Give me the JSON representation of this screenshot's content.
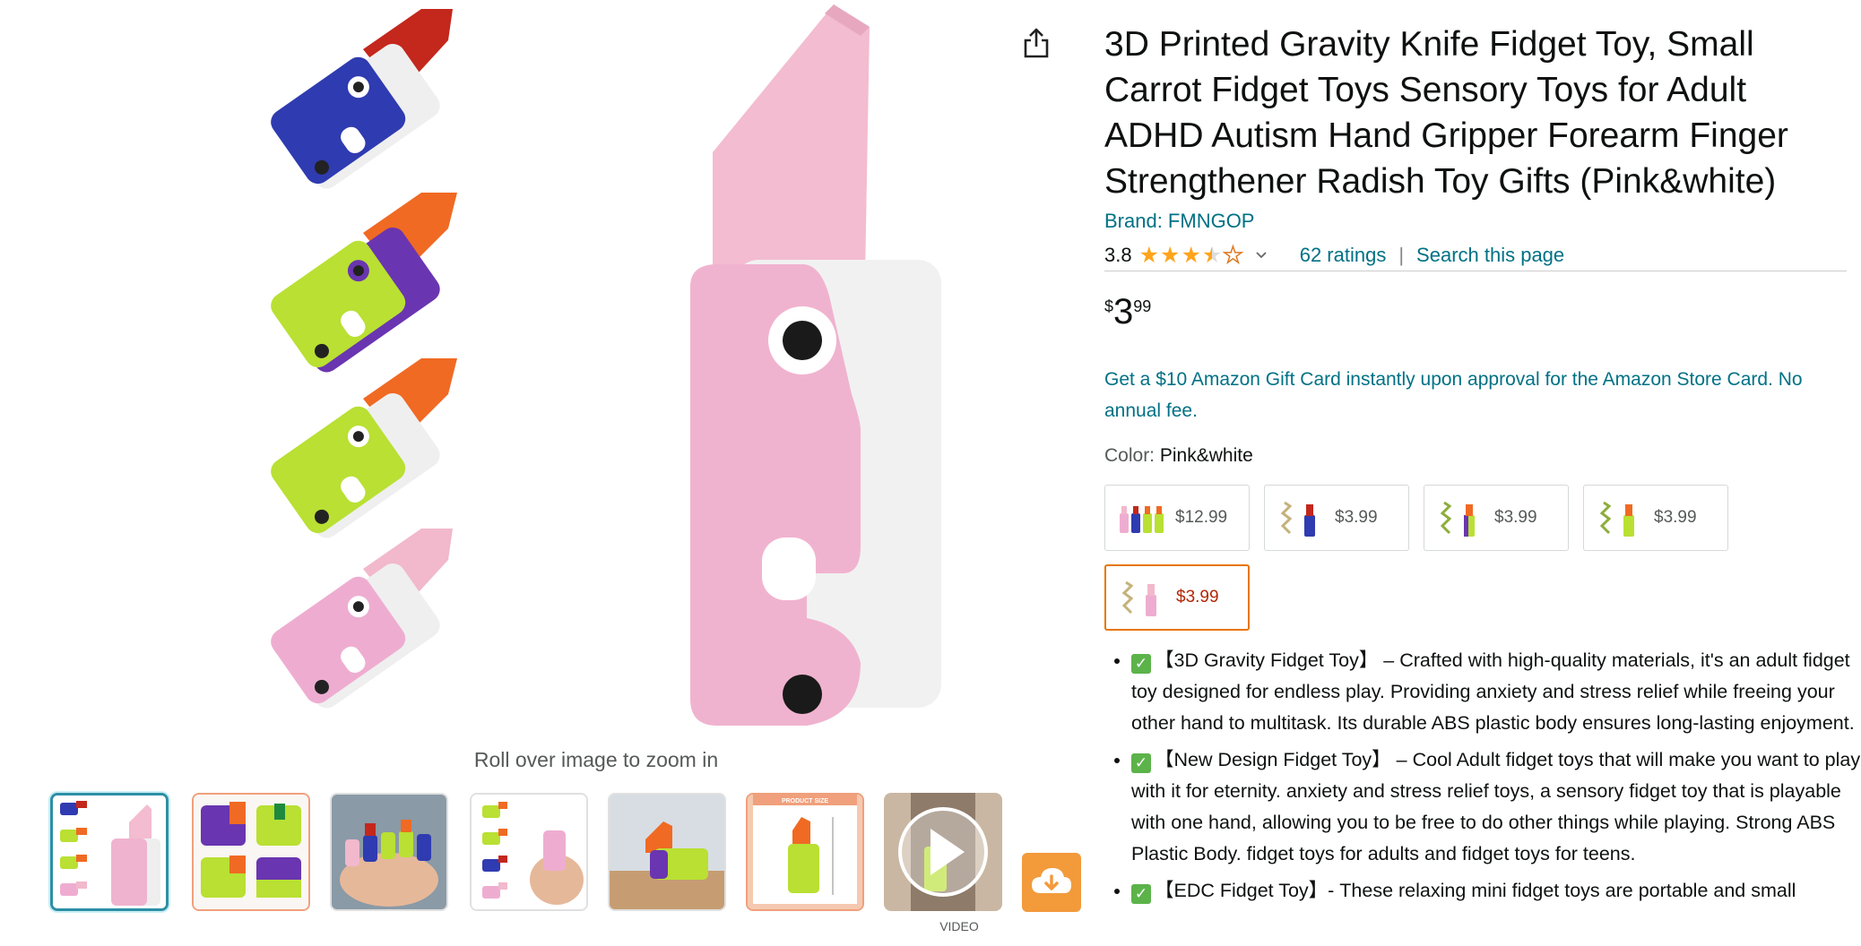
{
  "product": {
    "title": "3D Printed Gravity Knife Fidget Toy, Small Carrot Fidget Toys Sensory Toys for Adult ADHD Autism Hand Gripper Forearm Finger Strengthener Radish Toy Gifts (Pink&white)",
    "brand": "Brand: FMNGOP",
    "rating_value": "3.8",
    "rating_stars": 3.8,
    "ratings_link": "62 ratings",
    "separator": "|",
    "search_link": "Search this page",
    "price": {
      "symbol": "$",
      "whole": "3",
      "fraction": "99"
    },
    "promo": "Get a $10 Amazon Gift Card instantly upon approval for the Amazon Store Card. No annual fee."
  },
  "gallery": {
    "zoom_hint": "Roll over image to zoom in",
    "video_label": "VIDEO",
    "thumb_badge": "PRODUCT SIZE"
  },
  "color": {
    "label": "Color: ",
    "selected": "Pink&white",
    "options": [
      {
        "price": "$12.99"
      },
      {
        "price": "$3.99"
      },
      {
        "price": "$3.99"
      },
      {
        "price": "$3.99"
      },
      {
        "price": "$3.99"
      }
    ]
  },
  "bullets": [
    {
      "text": "【3D Gravity Fidget Toy】 – Crafted with high-quality materials, it's an adult fidget toy designed for endless play. Providing anxiety and stress relief while freeing your other hand to multitask. Its durable ABS plastic body ensures long-lasting enjoyment."
    },
    {
      "text": "【New Design Fidget Toy】 – Cool Adult fidget toys that will make you want to play with it for eternity. anxiety and stress relief toys, a sensory fidget toy that is playable with one hand, allowing you to be free to do other things while playing. Strong ABS Plastic Body. fidget toys for adults and fidget toys for teens."
    },
    {
      "text": "【EDC Fidget Toy】- These relaxing mini fidget toys are portable and small"
    }
  ],
  "colors": {
    "link": "#007185",
    "star": "#FFA41C",
    "selected_swatch": "#e77600",
    "swatch_price_selected": "#B12704",
    "thumb_selected": "#2d8fa6",
    "cloud_button": "#f39a3b"
  },
  "icons": [
    "share-icon",
    "star-icon",
    "chevron-down-icon",
    "play-icon",
    "cloud-download-icon",
    "check-icon"
  ]
}
